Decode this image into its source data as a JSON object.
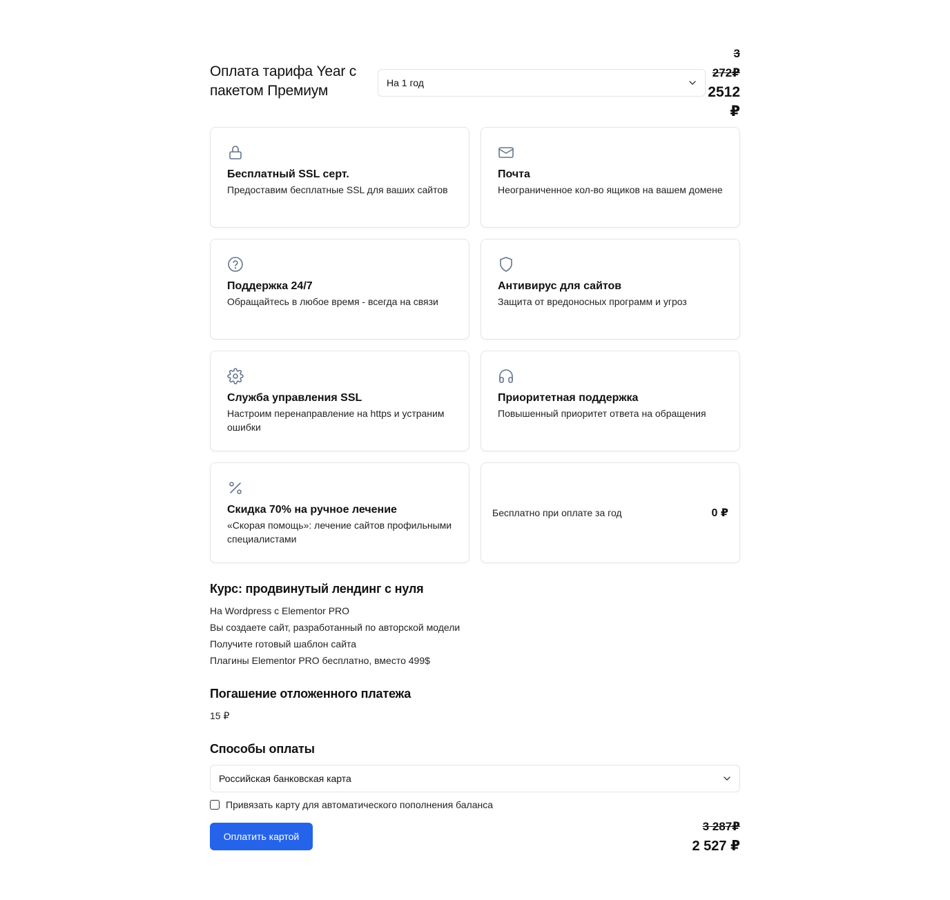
{
  "header": {
    "title": "Оплата тарифа Year с пакетом Премиум",
    "period_select": {
      "value": "На 1 год"
    },
    "price_old_line1": "3",
    "price_old_line2": "272₽",
    "price_new_line1": "2512",
    "price_new_line2": "₽"
  },
  "features": [
    {
      "icon": "lock-icon",
      "title": "Бесплатный SSL серт.",
      "desc": "Предоставим бесплатные SSL для ваших сайтов"
    },
    {
      "icon": "mail-icon",
      "title": "Почта",
      "desc": "Неограниченное кол-во ящиков на вашем домене"
    },
    {
      "icon": "help-circle-icon",
      "title": "Поддержка 24/7",
      "desc": "Обращайтесь в любое время - всегда на связи"
    },
    {
      "icon": "shield-icon",
      "title": "Антивирус для сайтов",
      "desc": "Защита от вредоносных программ и угроз"
    },
    {
      "icon": "gear-icon",
      "title": "Служба управления SSL",
      "desc": "Настроим перенаправление на https и устраним ошибки"
    },
    {
      "icon": "headphones-icon",
      "title": "Приоритетная поддержка",
      "desc": "Повышенный приоритет ответа на обращения"
    },
    {
      "icon": "percent-icon",
      "title": "Скидка 70% на ручное лечение",
      "desc": "«Скорая помощь»: лечение сайтов профильными специалистами"
    }
  ],
  "free_card": {
    "label": "Бесплатно при оплате за год",
    "amount": "0 ₽"
  },
  "course": {
    "title": "Курс: продвинутый лендинг с нуля",
    "items": [
      "На Wordpress с Elementor PRO",
      "Вы создаете сайт, разработанный по авторской модели",
      "Получите готовый шаблон сайта",
      "Плагины Elementor PRO бесплатно, вместо 499$"
    ]
  },
  "deferred": {
    "title": "Погашение отложенного платежа",
    "amount": "15 ₽"
  },
  "payment": {
    "title": "Способы оплаты",
    "method": "Российская банковская карта",
    "autopay_label": "Привязать карту для автоматического пополнения баланса",
    "autopay_checked": false,
    "pay_button": "Оплатить картой",
    "total_old": "3 287₽",
    "total_new": "2 527 ₽"
  },
  "colors": {
    "primary": "#2563eb",
    "icon": "#64748b",
    "border": "#e5e5e5"
  }
}
